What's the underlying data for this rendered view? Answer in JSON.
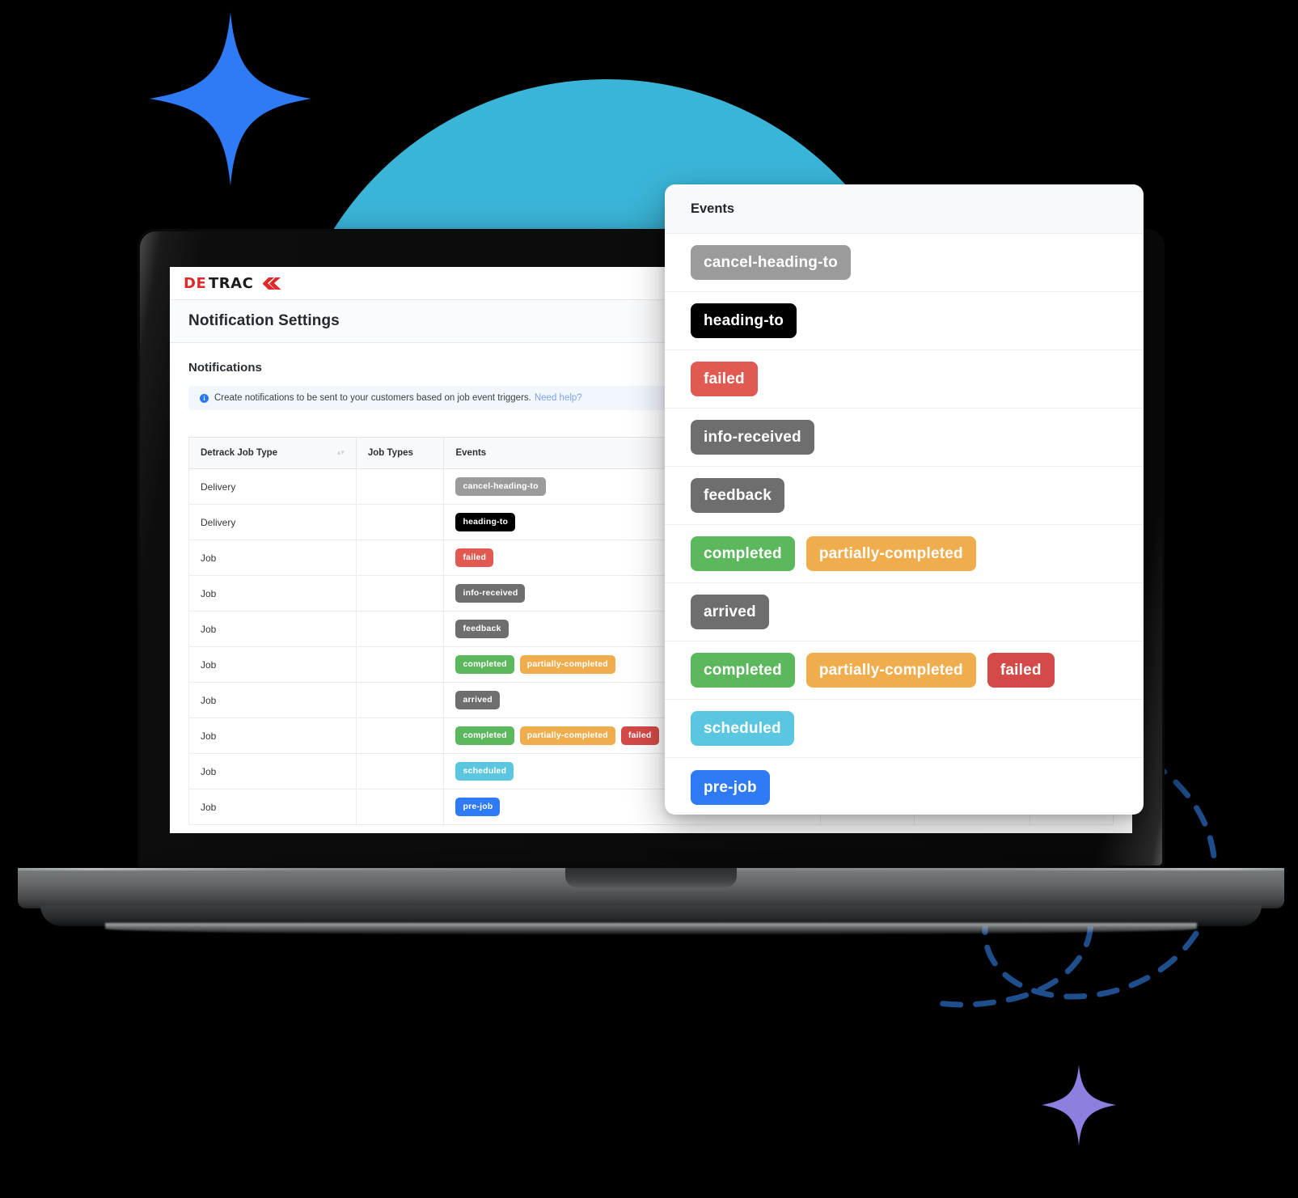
{
  "colors": {
    "teal_circle": "#3ab5d8",
    "sparkle_blue": "#2f7af5",
    "sparkle_purple": "#8b7fe0",
    "dashed_curve": "#1f4e8c",
    "logo_red": "#e02a2a",
    "logo_dark": "#1b1b1b",
    "link_blue": "#7fa2e8",
    "info_blue": "#2979f5",
    "badge_grey_light": "#9b9b9b",
    "badge_grey_dark": "#6e6e6e",
    "badge_black": "#000000",
    "badge_red": "#e05a52",
    "badge_red_dark": "#d34a48",
    "badge_green": "#5cb85c",
    "badge_orange": "#f0ad4e",
    "badge_cyan": "#5bc6e0",
    "badge_blue": "#2f7af5"
  },
  "app": {
    "logo_text_1": "DE",
    "logo_text_2": "TRAC",
    "logo_text_3": "K",
    "page_title": "Notification Settings",
    "section_title": "Notifications",
    "info_text": "Create notifications to be sent to your customers based on job event triggers.",
    "info_link": "Need help?",
    "info_icon_glyph": "i"
  },
  "table": {
    "headers": [
      "Detrack Job Type",
      "Job Types",
      "Events"
    ],
    "sort_icon": "▴▾",
    "rows": [
      {
        "job_type": "Delivery",
        "job_types": "",
        "events": [
          {
            "label": "cancel-heading-to",
            "color": "#9b9b9b"
          }
        ]
      },
      {
        "job_type": "Delivery",
        "job_types": "",
        "events": [
          {
            "label": "heading-to",
            "color": "#000000"
          }
        ]
      },
      {
        "job_type": "Job",
        "job_types": "",
        "events": [
          {
            "label": "failed",
            "color": "#e05a52"
          }
        ]
      },
      {
        "job_type": "Job",
        "job_types": "",
        "events": [
          {
            "label": "info-received",
            "color": "#6e6e6e"
          }
        ]
      },
      {
        "job_type": "Job",
        "job_types": "",
        "events": [
          {
            "label": "feedback",
            "color": "#6e6e6e"
          }
        ]
      },
      {
        "job_type": "Job",
        "job_types": "",
        "events": [
          {
            "label": "completed",
            "color": "#5cb85c"
          },
          {
            "label": "partially-completed",
            "color": "#f0ad4e"
          }
        ]
      },
      {
        "job_type": "Job",
        "job_types": "",
        "events": [
          {
            "label": "arrived",
            "color": "#6e6e6e"
          }
        ]
      },
      {
        "job_type": "Job",
        "job_types": "",
        "events": [
          {
            "label": "completed",
            "color": "#5cb85c"
          },
          {
            "label": "partially-completed",
            "color": "#f0ad4e"
          },
          {
            "label": "failed",
            "color": "#d34a48"
          }
        ]
      },
      {
        "job_type": "Job",
        "job_types": "",
        "events": [
          {
            "label": "scheduled",
            "color": "#5bc6e0"
          }
        ]
      },
      {
        "job_type": "Job",
        "job_types": "",
        "events": [
          {
            "label": "pre-job",
            "color": "#2f7af5"
          }
        ]
      }
    ]
  },
  "events_panel": {
    "title": "Events",
    "rows": [
      [
        {
          "label": "cancel-heading-to",
          "color": "#9b9b9b"
        }
      ],
      [
        {
          "label": "heading-to",
          "color": "#000000"
        }
      ],
      [
        {
          "label": "failed",
          "color": "#e05a52"
        }
      ],
      [
        {
          "label": "info-received",
          "color": "#6e6e6e"
        }
      ],
      [
        {
          "label": "feedback",
          "color": "#6e6e6e"
        }
      ],
      [
        {
          "label": "completed",
          "color": "#5cb85c"
        },
        {
          "label": "partially-completed",
          "color": "#f0ad4e"
        }
      ],
      [
        {
          "label": "arrived",
          "color": "#6e6e6e"
        }
      ],
      [
        {
          "label": "completed",
          "color": "#5cb85c"
        },
        {
          "label": "partially-completed",
          "color": "#f0ad4e"
        },
        {
          "label": "failed",
          "color": "#d34a48"
        }
      ],
      [
        {
          "label": "scheduled",
          "color": "#5bc6e0"
        }
      ],
      [
        {
          "label": "pre-job",
          "color": "#2f7af5"
        }
      ]
    ]
  }
}
